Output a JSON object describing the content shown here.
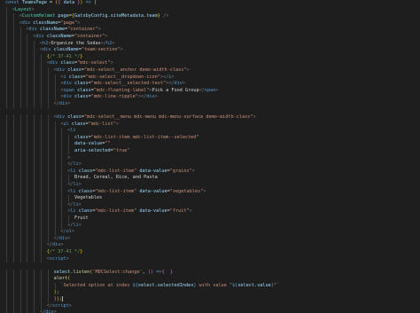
{
  "theme": {
    "background": "#1e1e1e",
    "colors": {
      "keyword": "#569cd6",
      "function": "#dcdcaa",
      "variable": "#9cdcfe",
      "component": "#4ec9b0",
      "string": "#ce9178",
      "comment": "#6a9955",
      "punctuation": "#808080",
      "text": "#d4d4d4"
    }
  },
  "cursor": {
    "line": 44
  },
  "lines": [
    {
      "indent": 0,
      "tokens": [
        [
          "kw",
          "const "
        ],
        [
          "var",
          "TeamsPage"
        ],
        [
          "txt",
          " = "
        ],
        [
          "br",
          "("
        ],
        [
          "br2",
          "{ "
        ],
        [
          "var",
          "data"
        ],
        [
          "br2",
          " }"
        ],
        [
          "br",
          ")"
        ],
        [
          "txt",
          " "
        ],
        [
          "kw",
          "=>"
        ],
        [
          "txt",
          " ("
        ]
      ]
    },
    {
      "indent": 1,
      "tokens": [
        [
          "pun",
          "<"
        ],
        [
          "comp",
          "Layout"
        ],
        [
          "pun",
          ">"
        ]
      ]
    },
    {
      "indent": 2,
      "tokens": [
        [
          "pun",
          "<"
        ],
        [
          "comp",
          "CustomHelmet"
        ],
        [
          "txt",
          " "
        ],
        [
          "attr",
          "page"
        ],
        [
          "txt",
          "="
        ],
        [
          "br",
          "{"
        ],
        [
          "var",
          "GatsbyConfig"
        ],
        [
          "txt",
          "."
        ],
        [
          "var",
          "siteMetadata"
        ],
        [
          "txt",
          "."
        ],
        [
          "var",
          "team"
        ],
        [
          "br",
          "}"
        ],
        [
          "txt",
          " "
        ],
        [
          "pun",
          "/>"
        ]
      ]
    },
    {
      "indent": 2,
      "tokens": [
        [
          "pun",
          "<"
        ],
        [
          "tag",
          "div"
        ],
        [
          "txt",
          " "
        ],
        [
          "attr",
          "className"
        ],
        [
          "txt",
          "="
        ],
        [
          "str",
          "\"page\""
        ],
        [
          "pun",
          ">"
        ]
      ]
    },
    {
      "indent": 3,
      "tokens": [
        [
          "pun",
          "<"
        ],
        [
          "tag",
          "div"
        ],
        [
          "txt",
          " "
        ],
        [
          "attr",
          "className"
        ],
        [
          "txt",
          "="
        ],
        [
          "str",
          "\"container\""
        ],
        [
          "pun",
          ">"
        ]
      ]
    },
    {
      "indent": 4,
      "tokens": [
        [
          "pun",
          "<"
        ],
        [
          "tag",
          "div"
        ],
        [
          "txt",
          " "
        ],
        [
          "attr",
          "className"
        ],
        [
          "txt",
          "="
        ],
        [
          "str",
          "\"container\""
        ],
        [
          "pun",
          ">"
        ]
      ]
    },
    {
      "indent": 5,
      "tokens": [
        [
          "pun",
          "<"
        ],
        [
          "tag",
          "h2"
        ],
        [
          "pun",
          ">"
        ],
        [
          "txt",
          "Organize the Sodas"
        ],
        [
          "pun",
          "</"
        ],
        [
          "tag",
          "h2"
        ],
        [
          "pun",
          ">"
        ]
      ]
    },
    {
      "indent": 5,
      "tokens": [
        [
          "pun",
          "<"
        ],
        [
          "tag",
          "div"
        ],
        [
          "txt",
          " "
        ],
        [
          "attr",
          "className"
        ],
        [
          "txt",
          "="
        ],
        [
          "str",
          "\"team-section\""
        ],
        [
          "pun",
          ">"
        ]
      ]
    },
    {
      "indent": 6,
      "tokens": [
        [
          "br",
          "{"
        ],
        [
          "cmt",
          "/* 37-41 */"
        ],
        [
          "br",
          "}"
        ]
      ]
    },
    {
      "indent": 6,
      "tokens": [
        [
          "pun",
          "<"
        ],
        [
          "tag",
          "div"
        ],
        [
          "txt",
          " "
        ],
        [
          "attr",
          "class"
        ],
        [
          "txt",
          "="
        ],
        [
          "str",
          "\"mdc-select\""
        ],
        [
          "pun",
          ">"
        ]
      ]
    },
    {
      "indent": 7,
      "tokens": [
        [
          "pun",
          "<"
        ],
        [
          "tag",
          "div"
        ],
        [
          "txt",
          " "
        ],
        [
          "attr",
          "class"
        ],
        [
          "txt",
          "="
        ],
        [
          "str",
          "\"mdc-select__anchor demo-width-class\""
        ],
        [
          "pun",
          ">"
        ]
      ]
    },
    {
      "indent": 8,
      "tokens": [
        [
          "pun",
          "<"
        ],
        [
          "tag",
          "i"
        ],
        [
          "txt",
          " "
        ],
        [
          "attr",
          "class"
        ],
        [
          "txt",
          "="
        ],
        [
          "str",
          "\"mdc-select__dropdown-icon\""
        ],
        [
          "pun",
          "></"
        ],
        [
          "tag",
          "i"
        ],
        [
          "pun",
          ">"
        ]
      ]
    },
    {
      "indent": 8,
      "tokens": [
        [
          "pun",
          "<"
        ],
        [
          "tag",
          "div"
        ],
        [
          "txt",
          " "
        ],
        [
          "attr",
          "class"
        ],
        [
          "txt",
          "="
        ],
        [
          "str",
          "\"mdc-select__selected-text\""
        ],
        [
          "pun",
          "></"
        ],
        [
          "tag",
          "div"
        ],
        [
          "pun",
          ">"
        ]
      ]
    },
    {
      "indent": 8,
      "tokens": [
        [
          "pun",
          "<"
        ],
        [
          "tag",
          "span"
        ],
        [
          "txt",
          " "
        ],
        [
          "attr",
          "class"
        ],
        [
          "txt",
          "="
        ],
        [
          "str",
          "\"mdc-floating-label\""
        ],
        [
          "pun",
          ">"
        ],
        [
          "txt",
          "Pick a Food Group"
        ],
        [
          "pun",
          "</"
        ],
        [
          "tag",
          "span"
        ],
        [
          "pun",
          ">"
        ]
      ]
    },
    {
      "indent": 8,
      "tokens": [
        [
          "pun",
          "<"
        ],
        [
          "tag",
          "div"
        ],
        [
          "txt",
          " "
        ],
        [
          "attr",
          "class"
        ],
        [
          "txt",
          "="
        ],
        [
          "str",
          "\"mdc-line-ripple\""
        ],
        [
          "pun",
          "></"
        ],
        [
          "tag",
          "div"
        ],
        [
          "pun",
          ">"
        ]
      ]
    },
    {
      "indent": 7,
      "tokens": [
        [
          "pun",
          "</"
        ],
        [
          "tag",
          "div"
        ],
        [
          "pun",
          ">"
        ]
      ]
    },
    {
      "indent": 0,
      "tokens": []
    },
    {
      "indent": 7,
      "tokens": [
        [
          "pun",
          "<"
        ],
        [
          "tag",
          "div"
        ],
        [
          "txt",
          " "
        ],
        [
          "attr",
          "class"
        ],
        [
          "txt",
          "="
        ],
        [
          "str",
          "\"mdc-select__menu mdc-menu mdc-menu-surface demo-width-class\""
        ],
        [
          "pun",
          ">"
        ]
      ]
    },
    {
      "indent": 8,
      "tokens": [
        [
          "pun",
          "<"
        ],
        [
          "tag",
          "ul"
        ],
        [
          "txt",
          " "
        ],
        [
          "attr",
          "class"
        ],
        [
          "txt",
          "="
        ],
        [
          "str",
          "\"mdc-list\""
        ],
        [
          "pun",
          ">"
        ]
      ]
    },
    {
      "indent": 9,
      "tokens": [
        [
          "pun",
          "<"
        ],
        [
          "tag",
          "li"
        ]
      ]
    },
    {
      "indent": 10,
      "tokens": [
        [
          "attr",
          "class"
        ],
        [
          "txt",
          "="
        ],
        [
          "str",
          "\"mdc-list-item mdc-list-item--selected\""
        ]
      ]
    },
    {
      "indent": 10,
      "tokens": [
        [
          "attr",
          "data-value"
        ],
        [
          "txt",
          "="
        ],
        [
          "str",
          "\"\""
        ]
      ]
    },
    {
      "indent": 10,
      "tokens": [
        [
          "attr",
          "aria-selected"
        ],
        [
          "txt",
          "="
        ],
        [
          "str",
          "\"true\""
        ]
      ]
    },
    {
      "indent": 9,
      "tokens": [
        [
          "pun",
          ">"
        ]
      ]
    },
    {
      "indent": 9,
      "tokens": [
        [
          "pun",
          "</"
        ],
        [
          "tag",
          "li"
        ],
        [
          "pun",
          ">"
        ]
      ]
    },
    {
      "indent": 9,
      "tokens": [
        [
          "pun",
          "<"
        ],
        [
          "tag",
          "li"
        ],
        [
          "txt",
          " "
        ],
        [
          "attr",
          "class"
        ],
        [
          "txt",
          "="
        ],
        [
          "str",
          "\"mdc-list-item\""
        ],
        [
          "txt",
          " "
        ],
        [
          "attr",
          "data-value"
        ],
        [
          "txt",
          "="
        ],
        [
          "str",
          "\"grains\""
        ],
        [
          "pun",
          ">"
        ]
      ]
    },
    {
      "indent": 10,
      "tokens": [
        [
          "txt",
          "Bread, Cereal, Rice, and Pasta"
        ]
      ]
    },
    {
      "indent": 9,
      "tokens": [
        [
          "pun",
          "</"
        ],
        [
          "tag",
          "li"
        ],
        [
          "pun",
          ">"
        ]
      ]
    },
    {
      "indent": 9,
      "tokens": [
        [
          "pun",
          "<"
        ],
        [
          "tag",
          "li"
        ],
        [
          "txt",
          " "
        ],
        [
          "attr",
          "class"
        ],
        [
          "txt",
          "="
        ],
        [
          "str",
          "\"mdc-list-item\""
        ],
        [
          "txt",
          " "
        ],
        [
          "attr",
          "data-value"
        ],
        [
          "txt",
          "="
        ],
        [
          "str",
          "\"vegetables\""
        ],
        [
          "pun",
          ">"
        ]
      ]
    },
    {
      "indent": 10,
      "tokens": [
        [
          "txt",
          "Vegetables"
        ]
      ]
    },
    {
      "indent": 9,
      "tokens": [
        [
          "pun",
          "</"
        ],
        [
          "tag",
          "li"
        ],
        [
          "pun",
          ">"
        ]
      ]
    },
    {
      "indent": 9,
      "tokens": [
        [
          "pun",
          "<"
        ],
        [
          "tag",
          "li"
        ],
        [
          "txt",
          " "
        ],
        [
          "attr",
          "class"
        ],
        [
          "txt",
          "="
        ],
        [
          "str",
          "\"mdc-list-item\""
        ],
        [
          "txt",
          " "
        ],
        [
          "attr",
          "data-value"
        ],
        [
          "txt",
          "="
        ],
        [
          "str",
          "\"fruit\""
        ],
        [
          "pun",
          ">"
        ]
      ]
    },
    {
      "indent": 10,
      "tokens": [
        [
          "txt",
          "Fruit"
        ]
      ]
    },
    {
      "indent": 9,
      "tokens": [
        [
          "pun",
          "</"
        ],
        [
          "tag",
          "li"
        ],
        [
          "pun",
          ">"
        ]
      ]
    },
    {
      "indent": 8,
      "tokens": [
        [
          "pun",
          "</"
        ],
        [
          "tag",
          "ul"
        ],
        [
          "pun",
          ">"
        ]
      ]
    },
    {
      "indent": 7,
      "tokens": [
        [
          "pun",
          "</"
        ],
        [
          "tag",
          "div"
        ],
        [
          "pun",
          ">"
        ]
      ]
    },
    {
      "indent": 6,
      "tokens": [
        [
          "pun",
          "</"
        ],
        [
          "tag",
          "div"
        ],
        [
          "pun",
          ">"
        ]
      ]
    },
    {
      "indent": 6,
      "tokens": [
        [
          "br",
          "{"
        ],
        [
          "cmt",
          "/* 37-41 */"
        ],
        [
          "br",
          "}"
        ]
      ]
    },
    {
      "indent": 6,
      "tokens": [
        [
          "pun",
          "<"
        ],
        [
          "tag",
          "script"
        ],
        [
          "pun",
          ">"
        ]
      ]
    },
    {
      "indent": 0,
      "tokens": []
    },
    {
      "indent": 7,
      "tokens": [
        [
          "var",
          "select"
        ],
        [
          "txt",
          "."
        ],
        [
          "fn",
          "listen"
        ],
        [
          "br",
          "("
        ],
        [
          "str",
          "'MDCSelect:change'"
        ],
        [
          "txt",
          ", "
        ],
        [
          "br2",
          "()"
        ],
        [
          "txt",
          " "
        ],
        [
          "kw",
          "=>"
        ],
        [
          "br2",
          "{"
        ],
        [
          "txt",
          "  "
        ],
        [
          "br2",
          "}"
        ]
      ]
    },
    {
      "indent": 7,
      "tokens": [
        [
          "fn",
          "alert"
        ],
        [
          "br",
          "("
        ]
      ]
    },
    {
      "indent": 8,
      "tokens": [
        [
          "str",
          "`Selected option at index "
        ],
        [
          "tpl",
          "${"
        ],
        [
          "var",
          "select"
        ],
        [
          "txt",
          "."
        ],
        [
          "var",
          "selectedIndex"
        ],
        [
          "tpl",
          "}"
        ],
        [
          "str",
          " with value \""
        ],
        [
          "tpl",
          "${"
        ],
        [
          "var",
          "select"
        ],
        [
          "txt",
          "."
        ],
        [
          "var",
          "value"
        ],
        [
          "tpl",
          "}"
        ],
        [
          "str",
          "\"`"
        ]
      ]
    },
    {
      "indent": 7,
      "tokens": [
        [
          "br",
          ")"
        ],
        [
          "txt",
          ";"
        ]
      ]
    },
    {
      "indent": 7,
      "tokens": [
        [
          "br2",
          "}"
        ],
        [
          "br",
          ")"
        ],
        [
          "txt",
          ";"
        ]
      ]
    },
    {
      "indent": 6,
      "tokens": [
        [
          "pun",
          "</"
        ],
        [
          "tag",
          "script"
        ],
        [
          "pun",
          ">"
        ]
      ]
    },
    {
      "indent": 5,
      "tokens": [
        [
          "pun",
          "</"
        ],
        [
          "tag",
          "div"
        ],
        [
          "pun",
          ">"
        ]
      ]
    },
    {
      "indent": 4,
      "tokens": [
        [
          "pun",
          "</"
        ],
        [
          "tag",
          "div"
        ],
        [
          "pun",
          ">"
        ]
      ]
    }
  ]
}
